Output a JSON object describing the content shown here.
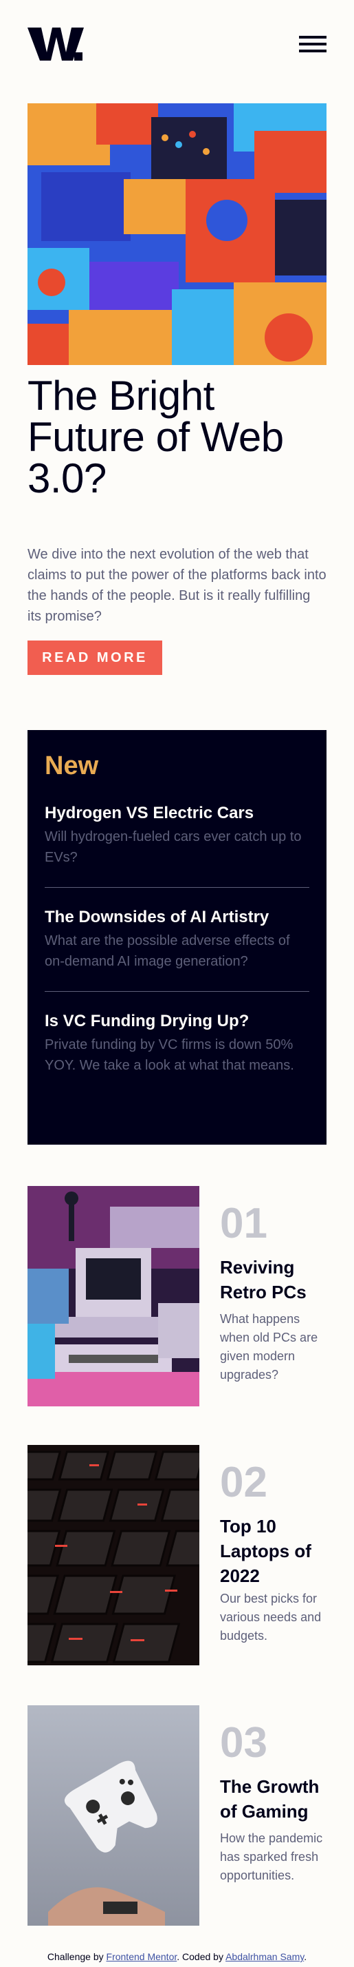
{
  "header": {
    "logo_text": "W.",
    "menu_icon": "hamburger-menu-icon"
  },
  "hero": {
    "title": "The Bright Future of Web 3.0?",
    "description": "We dive into the next evolution of the web that claims to put the power of the platforms back into the hands of the people. But is it really fulfilling its promise?",
    "button_label": "READ MORE"
  },
  "new_section": {
    "title": "New",
    "items": [
      {
        "title": "Hydrogen VS Electric Cars",
        "description": "Will hydrogen-fueled cars ever catch up to EVs?"
      },
      {
        "title": "The Downsides of AI Artistry",
        "description": "What are the possible adverse effects of on-demand AI image generation?"
      },
      {
        "title": "Is VC Funding Drying Up?",
        "description": "Private funding by VC firms is down 50% YOY. We take a look at what that means."
      }
    ]
  },
  "articles": [
    {
      "number": "01",
      "title": "Reviving Retro PCs",
      "description": "What happens when old PCs are given modern upgrades?"
    },
    {
      "number": "02",
      "title": "Top 10 Laptops of 2022",
      "description": "Our best picks for various needs and budgets."
    },
    {
      "number": "03",
      "title": "The Growth of Gaming",
      "description": "How the pandemic has sparked fresh opportunities."
    }
  ],
  "footer": {
    "prefix": "Challenge by ",
    "challenge_link": "Frontend Mentor",
    "middle": ". Coded by ",
    "author_link": "Abdalrhman Samy",
    "suffix": "."
  },
  "colors": {
    "accent": "#f15e50",
    "new_accent": "#e9ab53",
    "dark": "#00001a",
    "muted": "#5d5f79",
    "background": "#fdfcf9"
  }
}
